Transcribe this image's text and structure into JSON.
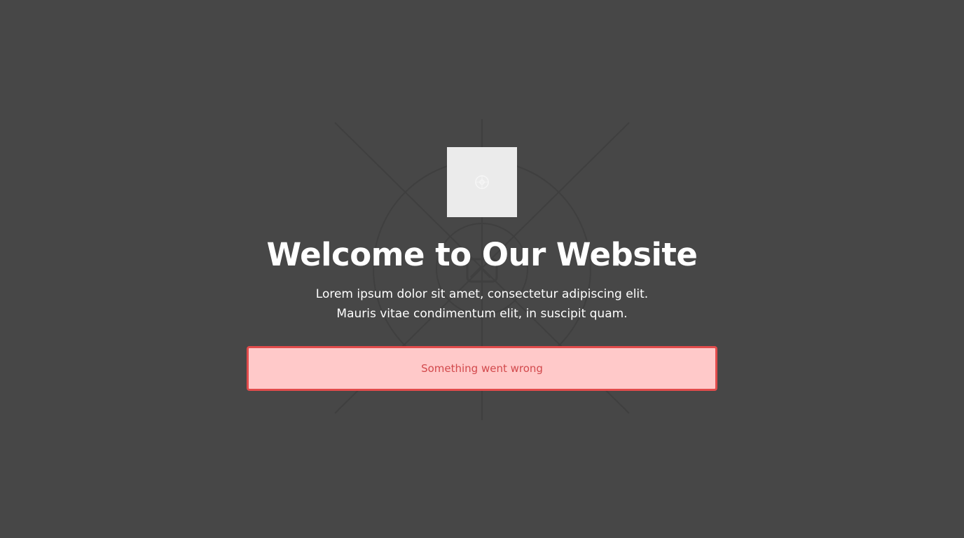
{
  "hero": {
    "title": "Welcome to Our Website",
    "subtitle_lines": [
      "Lorem ipsum dolor sit amet, consectetur adipiscing elit.",
      "Mauris vitae condimentum elit, in suscipit quam."
    ]
  },
  "logo": {
    "icon": "image-placeholder-icon"
  },
  "alert": {
    "message": "Something went wrong",
    "background": "#ffc9c9",
    "border": "#e14b4b",
    "text_color": "#d2494c"
  },
  "colors": {
    "page_background": "#474747",
    "heading": "#ffffff"
  }
}
